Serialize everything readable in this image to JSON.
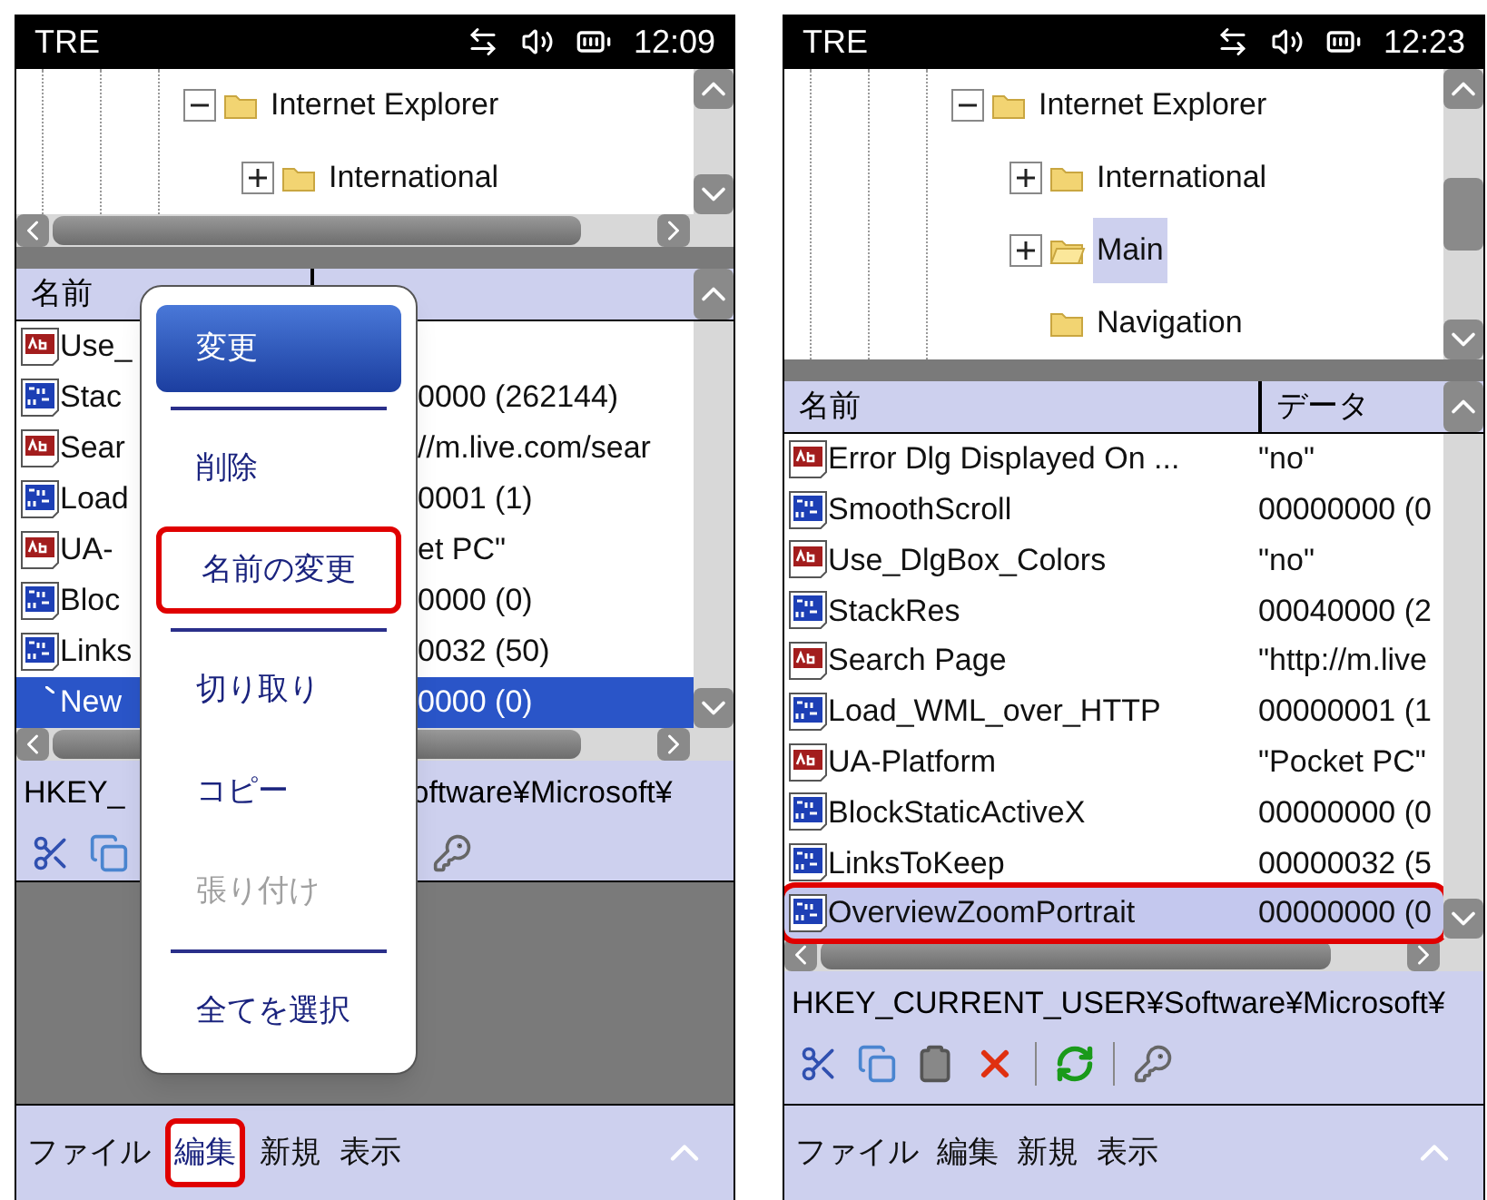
{
  "phones": [
    {
      "status_bar": {
        "title": "TRE",
        "time": "12:09"
      },
      "tree": [
        {
          "label": "Internet Explorer",
          "expanded": true,
          "selected": false,
          "children": [
            {
              "label": "International",
              "expanded": false,
              "selected": false
            }
          ]
        }
      ],
      "list": {
        "columns": [
          "名前"
        ],
        "rows": [
          {
            "kind": "string",
            "name": "Use_",
            "selected": false
          },
          {
            "kind": "binary",
            "name": "Stac",
            "data": "0000 (262144)",
            "selected": false
          },
          {
            "kind": "string",
            "name": "Sear",
            "data": "//m.live.com/sear",
            "selected": false
          },
          {
            "kind": "binary",
            "name": "Load",
            "data": "0001 (1)",
            "selected": false
          },
          {
            "kind": "string",
            "name": "UA-",
            "data": "et PC\"",
            "selected": false
          },
          {
            "kind": "binary",
            "name": "Bloc",
            "data": "0000 (0)",
            "selected": false
          },
          {
            "kind": "binary",
            "name": "Links",
            "data": "0032 (50)",
            "selected": false
          },
          {
            "kind": "new",
            "name": "New",
            "data": "0000 (0)",
            "selected": true
          }
        ]
      },
      "path": [
        "HKEY_",
        "oftware¥Microsoft¥"
      ],
      "toolbar": [
        {
          "kind": "cut"
        },
        {
          "kind": "copy"
        },
        {
          "kind": "key"
        }
      ],
      "popup_menu": [
        {
          "kind": "item",
          "label": "変更",
          "selected": true,
          "disabled": false,
          "highlighted": false
        },
        {
          "kind": "separator"
        },
        {
          "kind": "item",
          "label": "削除",
          "selected": false,
          "disabled": false,
          "highlighted": false
        },
        {
          "kind": "item",
          "label": "名前の変更",
          "selected": false,
          "disabled": false,
          "highlighted": true
        },
        {
          "kind": "separator"
        },
        {
          "kind": "item",
          "label": "切り取り",
          "selected": false,
          "disabled": false,
          "highlighted": false
        },
        {
          "kind": "item",
          "label": "コピー",
          "selected": false,
          "disabled": false,
          "highlighted": false
        },
        {
          "kind": "item",
          "label": "張り付け",
          "selected": false,
          "disabled": true,
          "highlighted": false
        },
        {
          "kind": "separator"
        },
        {
          "kind": "item",
          "label": "全てを選択",
          "selected": false,
          "disabled": false,
          "highlighted": false
        }
      ],
      "menu_bar": [
        {
          "label": "ファイル",
          "selected": false,
          "highlighted": false
        },
        {
          "label": "編集",
          "selected": true,
          "highlighted": true
        },
        {
          "label": "新規",
          "selected": false,
          "highlighted": false
        },
        {
          "label": "表示",
          "selected": false,
          "highlighted": false
        }
      ]
    },
    {
      "status_bar": {
        "title": "TRE",
        "time": "12:23"
      },
      "tree": [
        {
          "label": "Internet Explorer",
          "expanded": true,
          "selected": false,
          "children": [
            {
              "label": "International",
              "expanded": false,
              "selected": false
            },
            {
              "label": "Main",
              "expanded": false,
              "selected": true
            },
            {
              "label": "Navigation",
              "selected": false
            }
          ]
        }
      ],
      "list": {
        "columns": [
          "名前",
          "データ"
        ],
        "rows": [
          {
            "kind": "string",
            "name": "Error Dlg Displayed On ...",
            "data": "\"no\"",
            "selected": false,
            "highlighted": false
          },
          {
            "kind": "binary",
            "name": "SmoothScroll",
            "data": "00000000 (0",
            "selected": false,
            "highlighted": false
          },
          {
            "kind": "string",
            "name": "Use_DlgBox_Colors",
            "data": "\"no\"",
            "selected": false,
            "highlighted": false
          },
          {
            "kind": "binary",
            "name": "StackRes",
            "data": "00040000 (2",
            "selected": false,
            "highlighted": false
          },
          {
            "kind": "string",
            "name": "Search Page",
            "data": "\"http://m.live",
            "selected": false,
            "highlighted": false
          },
          {
            "kind": "binary",
            "name": "Load_WML_over_HTTP",
            "data": "00000001 (1",
            "selected": false,
            "highlighted": false
          },
          {
            "kind": "string",
            "name": "UA-Platform",
            "data": "\"Pocket PC\"",
            "selected": false,
            "highlighted": false
          },
          {
            "kind": "binary",
            "name": "BlockStaticActiveX",
            "data": "00000000 (0",
            "selected": false,
            "highlighted": false
          },
          {
            "kind": "binary",
            "name": "LinksToKeep",
            "data": "00000032 (5",
            "selected": false,
            "highlighted": false
          },
          {
            "kind": "binary",
            "name": "OverviewZoomPortrait",
            "data": "00000000 (0",
            "selected": true,
            "highlighted": true
          }
        ]
      },
      "path": [
        "HKEY_CURRENT_USER¥Software¥Microsoft¥"
      ],
      "toolbar": [
        {
          "kind": "cut"
        },
        {
          "kind": "copy"
        },
        {
          "kind": "paste"
        },
        {
          "kind": "delete"
        },
        {
          "kind": "separator"
        },
        {
          "kind": "refresh"
        },
        {
          "kind": "separator"
        },
        {
          "kind": "key"
        }
      ],
      "menu_bar": [
        {
          "label": "ファイル",
          "selected": false,
          "highlighted": false
        },
        {
          "label": "編集",
          "selected": false,
          "highlighted": false
        },
        {
          "label": "新規",
          "selected": false,
          "highlighted": false
        },
        {
          "label": "表示",
          "selected": false,
          "highlighted": false
        }
      ]
    }
  ]
}
